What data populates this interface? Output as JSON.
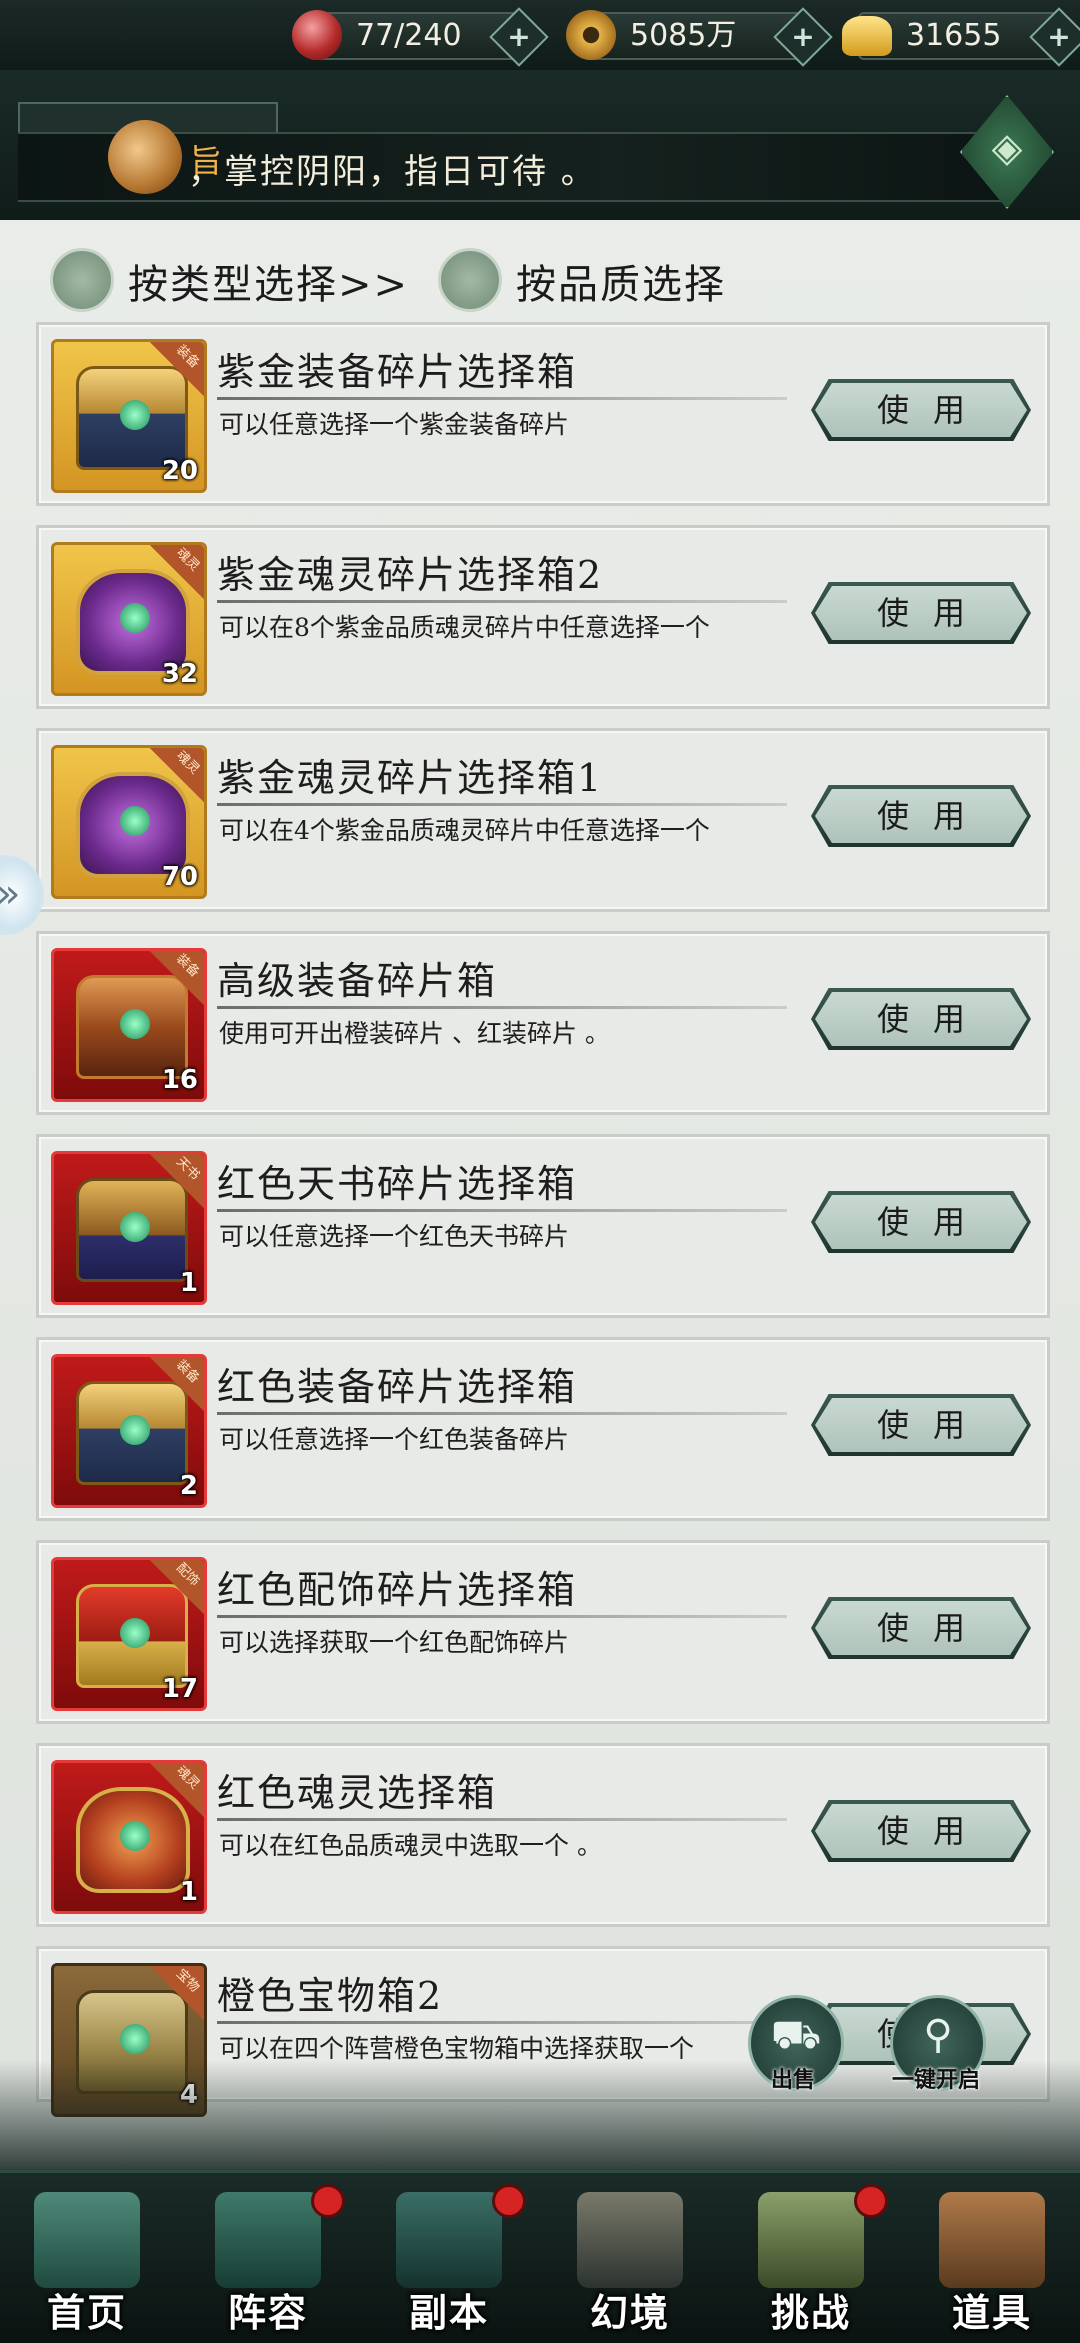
{
  "resources": [
    {
      "icon": "stamina-orb-icon",
      "value": "77/240"
    },
    {
      "icon": "coin-icon",
      "value": "5085万"
    },
    {
      "icon": "ingot-icon",
      "value": "31655"
    }
  ],
  "marquee": {
    "prefix": "旨",
    "text": "，掌控阴阳，指日可待 。"
  },
  "filters": {
    "by_type": "按类型选择>>",
    "by_quality": "按品质选择"
  },
  "use_label": "使用",
  "items": [
    {
      "name": "紫金装备碎片选择箱",
      "desc": "可以任意选择一个紫金装备碎片",
      "qty": "20",
      "frame": "gold",
      "chest": "gold",
      "tag": "装备"
    },
    {
      "name": "紫金魂灵碎片选择箱2",
      "desc": "可以在8个紫金品质魂灵碎片中任意选择一个",
      "qty": "32",
      "frame": "gold",
      "chest": "purple",
      "tag": "魂灵"
    },
    {
      "name": "紫金魂灵碎片选择箱1",
      "desc": "可以在4个紫金品质魂灵碎片中任意选择一个",
      "qty": "70",
      "frame": "gold",
      "chest": "purple",
      "tag": "魂灵"
    },
    {
      "name": "高级装备碎片箱",
      "desc": "使用可开出橙装碎片 、红装碎片 。",
      "qty": "16",
      "frame": "red",
      "chest": "redc",
      "tag": "装备"
    },
    {
      "name": "红色天书碎片选择箱",
      "desc": "可以任意选择一个红色天书碎片",
      "qty": "1",
      "frame": "red",
      "chest": "book",
      "tag": "天书"
    },
    {
      "name": "红色装备碎片选择箱",
      "desc": "可以任意选择一个红色装备碎片",
      "qty": "2",
      "frame": "red",
      "chest": "gold",
      "tag": "装备"
    },
    {
      "name": "红色配饰碎片选择箱",
      "desc": "可以选择获取一个红色配饰碎片",
      "qty": "17",
      "frame": "red",
      "chest": "ornate",
      "tag": "配饰"
    },
    {
      "name": "红色魂灵选择箱",
      "desc": "可以在红色品质魂灵中选取一个 。",
      "qty": "1",
      "frame": "red",
      "chest": "soulred",
      "tag": "魂灵"
    },
    {
      "name": "橙色宝物箱2",
      "desc": "可以在四个阵营橙色宝物箱中选择获取一个",
      "qty": "4",
      "frame": "brown",
      "chest": "treasure",
      "tag": "宝物"
    }
  ],
  "actions": {
    "sell": "出售",
    "open_all": "一键开启"
  },
  "nav": [
    {
      "label": "首页",
      "badge": false
    },
    {
      "label": "阵容",
      "badge": true
    },
    {
      "label": "副本",
      "badge": true
    },
    {
      "label": "幻境",
      "badge": false
    },
    {
      "label": "挑战",
      "badge": true
    },
    {
      "label": "道具",
      "badge": false
    }
  ],
  "colors": {
    "accent": "#3b5a52",
    "panel": "#e9ece8",
    "badge": "#d62424"
  }
}
